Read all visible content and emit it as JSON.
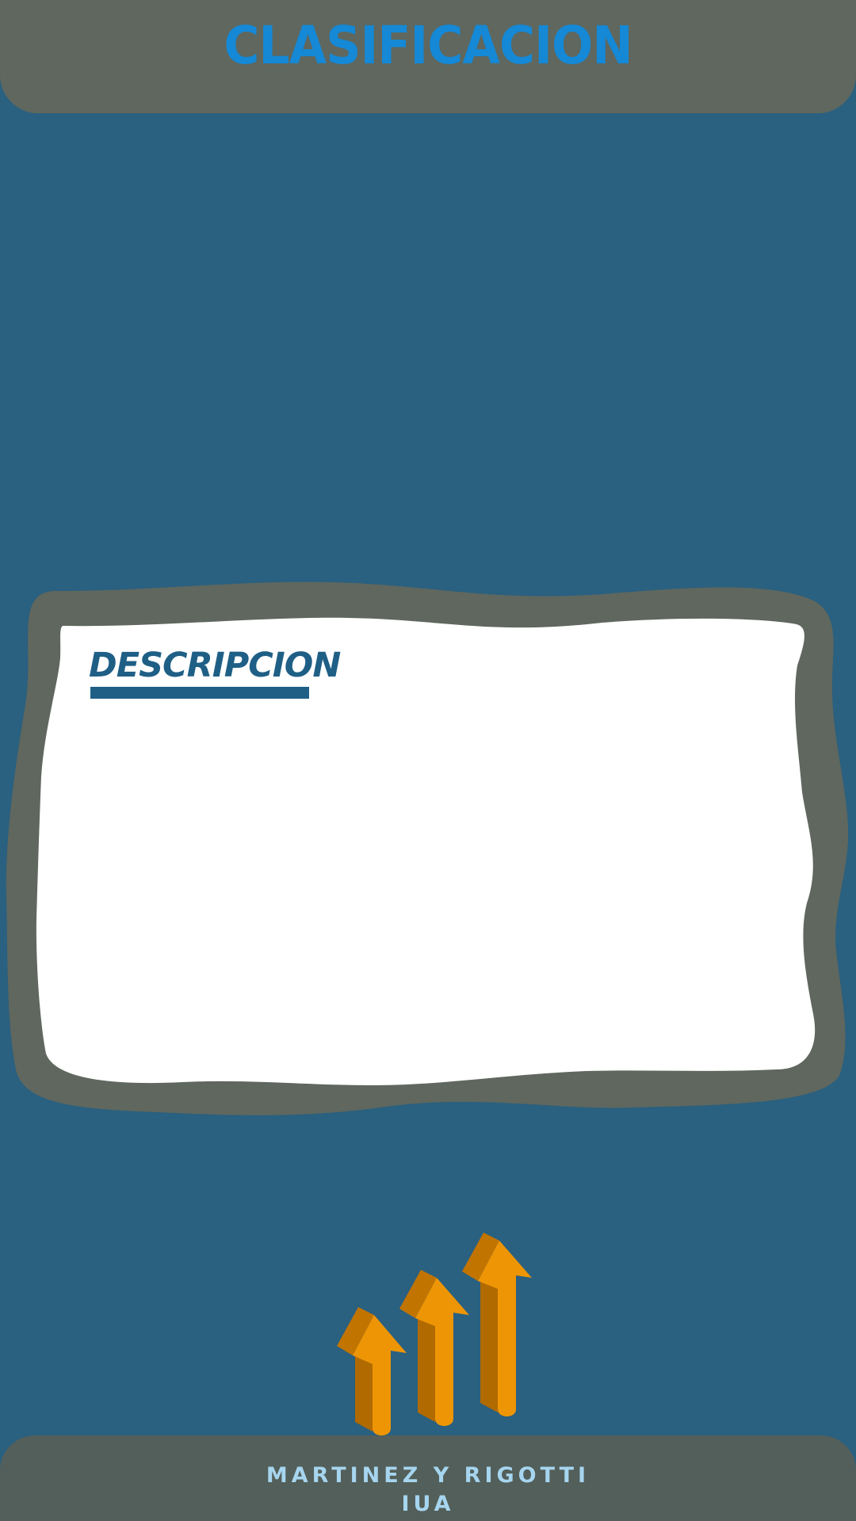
{
  "header": {
    "title": "CLASIFICACION"
  },
  "card": {
    "heading": "DESCRIPCION"
  },
  "footer": {
    "authors": "MARTINEZ Y RIGOTTI",
    "institution": "IUA"
  },
  "colors": {
    "background": "#2a6080",
    "header_bar": "#5f675e",
    "title_text": "#1588d6",
    "card_border": "#5f675e",
    "card_fill": "#ffffff",
    "heading_text": "#1f5f86",
    "arrow_light": "#ee9505",
    "arrow_dark": "#c27400",
    "footer_bar": "#535f5a",
    "footer_text": "#a6d5ef"
  },
  "decorations": {
    "arrows": "three-rising-arrows-icon"
  }
}
